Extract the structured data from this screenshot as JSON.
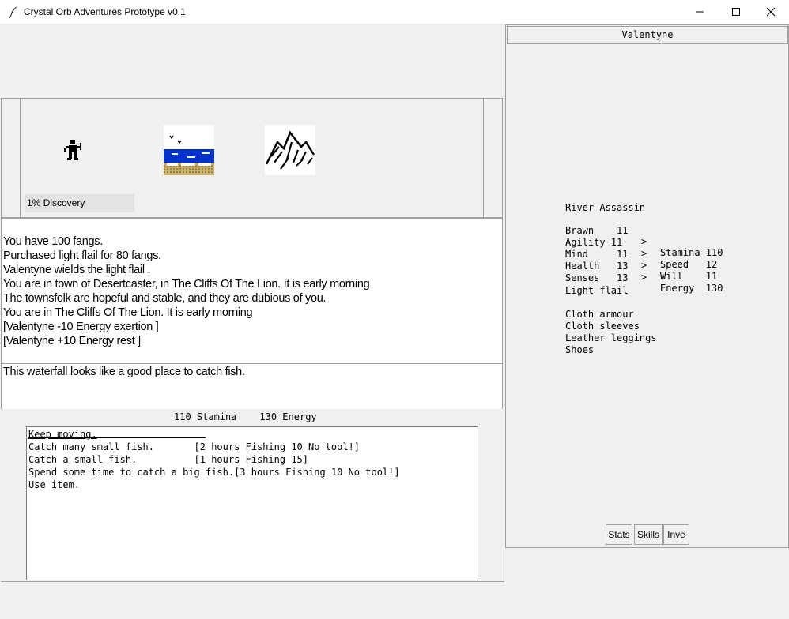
{
  "window": {
    "title": "Crystal Orb Adventures Prototype v0.1"
  },
  "map": {
    "discovery": "1% Discovery",
    "tiles": [
      "player-figure-icon",
      "lake-tile-icon",
      "mountain-tile-icon"
    ]
  },
  "log": {
    "lines": [
      "You have 100 fangs.",
      "Purchased light flail  for 80 fangs.",
      "Valentyne wields the light flail .",
      "You are in town of Desertcaster, in The Cliffs Of The Lion. It is early morning",
      "The townsfolk are hopeful and stable, and they are dubious of you.",
      "You are in The Cliffs Of The Lion. It is  early morning",
      "[Valentyne -10 Energy exertion ]",
      "[Valentyne +10 Energy rest ]"
    ]
  },
  "description": "This waterfall looks like a good place to catch fish.",
  "status": {
    "stamina": "110 Stamina",
    "energy": "130 Energy"
  },
  "actions": [
    "Keep moving.",
    "Catch many small fish.       [2 hours Fishing 10 No tool!]",
    "Catch a small fish.          [1 hours Fishing 15]",
    "Spend some time to catch a big fish.[3 hours Fishing 10 No tool!]",
    "Use item."
  ],
  "character": {
    "name": "Valentyne",
    "class": "River Assassin",
    "stats": [
      {
        "left": "Brawn    11",
        "arrow": ">",
        "right": "Stamina 110"
      },
      {
        "left": "Agility 11",
        "arrow": ">",
        "right": "Speed   12"
      },
      {
        "left": "Mind     11",
        "arrow": ">",
        "right": "Will    11"
      },
      {
        "left": "Health   13",
        "arrow": ">",
        "right": "Energy  130"
      },
      {
        "left": "Senses   13",
        "arrow": "",
        "right": ""
      }
    ],
    "weapon": "Light flail",
    "armour": [
      "Cloth armour",
      "Cloth sleeves",
      "Leather leggings",
      "Shoes"
    ]
  },
  "tabs": [
    "Stats",
    "Skills",
    "Inve"
  ],
  "colors": {
    "background": "#f0f0f0",
    "panel_white": "#ffffff",
    "border": "#a0a0a0",
    "lake_blue": "#0033cc",
    "sand": "#b89a3c"
  }
}
